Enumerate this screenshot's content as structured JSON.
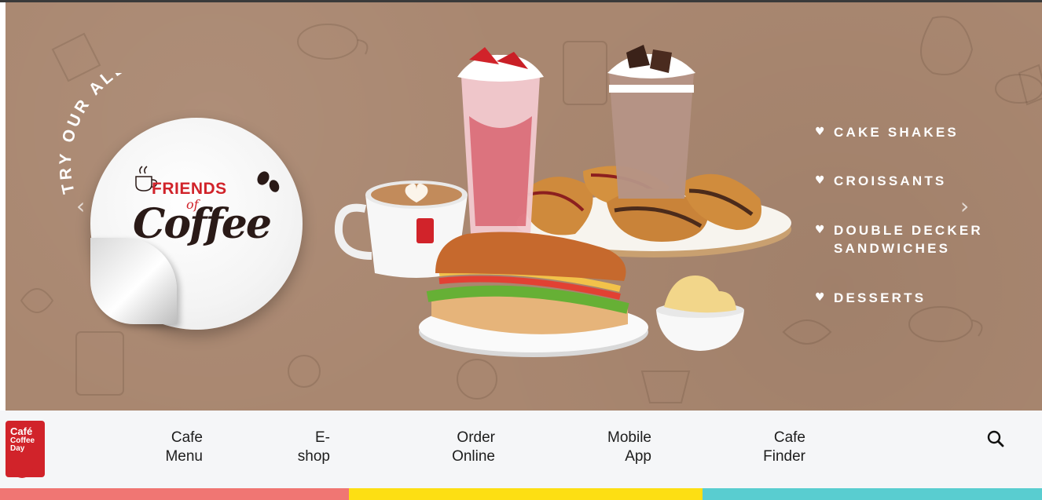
{
  "hero": {
    "tagline": "TRY OUR ALL-NEW MENU",
    "badge": {
      "line1": "FRIENDS",
      "line2": "of",
      "line3": "Coffee"
    },
    "prev_arrow": "‹",
    "next_arrow": "›",
    "menu_items": [
      {
        "lines": [
          "CAKE SHAKES"
        ]
      },
      {
        "lines": [
          "CROISSANTS"
        ]
      },
      {
        "lines": [
          "DOUBLE DECKER",
          "SANDWICHES"
        ]
      },
      {
        "lines": [
          "DESSERTS"
        ]
      }
    ],
    "bullet": "♥",
    "colors": {
      "background": "#a98770",
      "accent": "#d1232a"
    }
  },
  "nav": {
    "logo_lines": [
      "Café",
      "Coffee",
      "Day"
    ],
    "logo_reg": "®",
    "links": [
      {
        "line1": "Cafe",
        "line2": "Menu"
      },
      {
        "line1": "E-",
        "line2": "shop"
      },
      {
        "line1": "Order",
        "line2": "Online"
      },
      {
        "line1": "Mobile",
        "line2": "App"
      },
      {
        "line1": "Cafe",
        "line2": "Finder"
      }
    ],
    "search_icon": "search-icon"
  },
  "stripes": {
    "colors": [
      "#f07673",
      "#fddf13",
      "#59cdd0"
    ]
  }
}
